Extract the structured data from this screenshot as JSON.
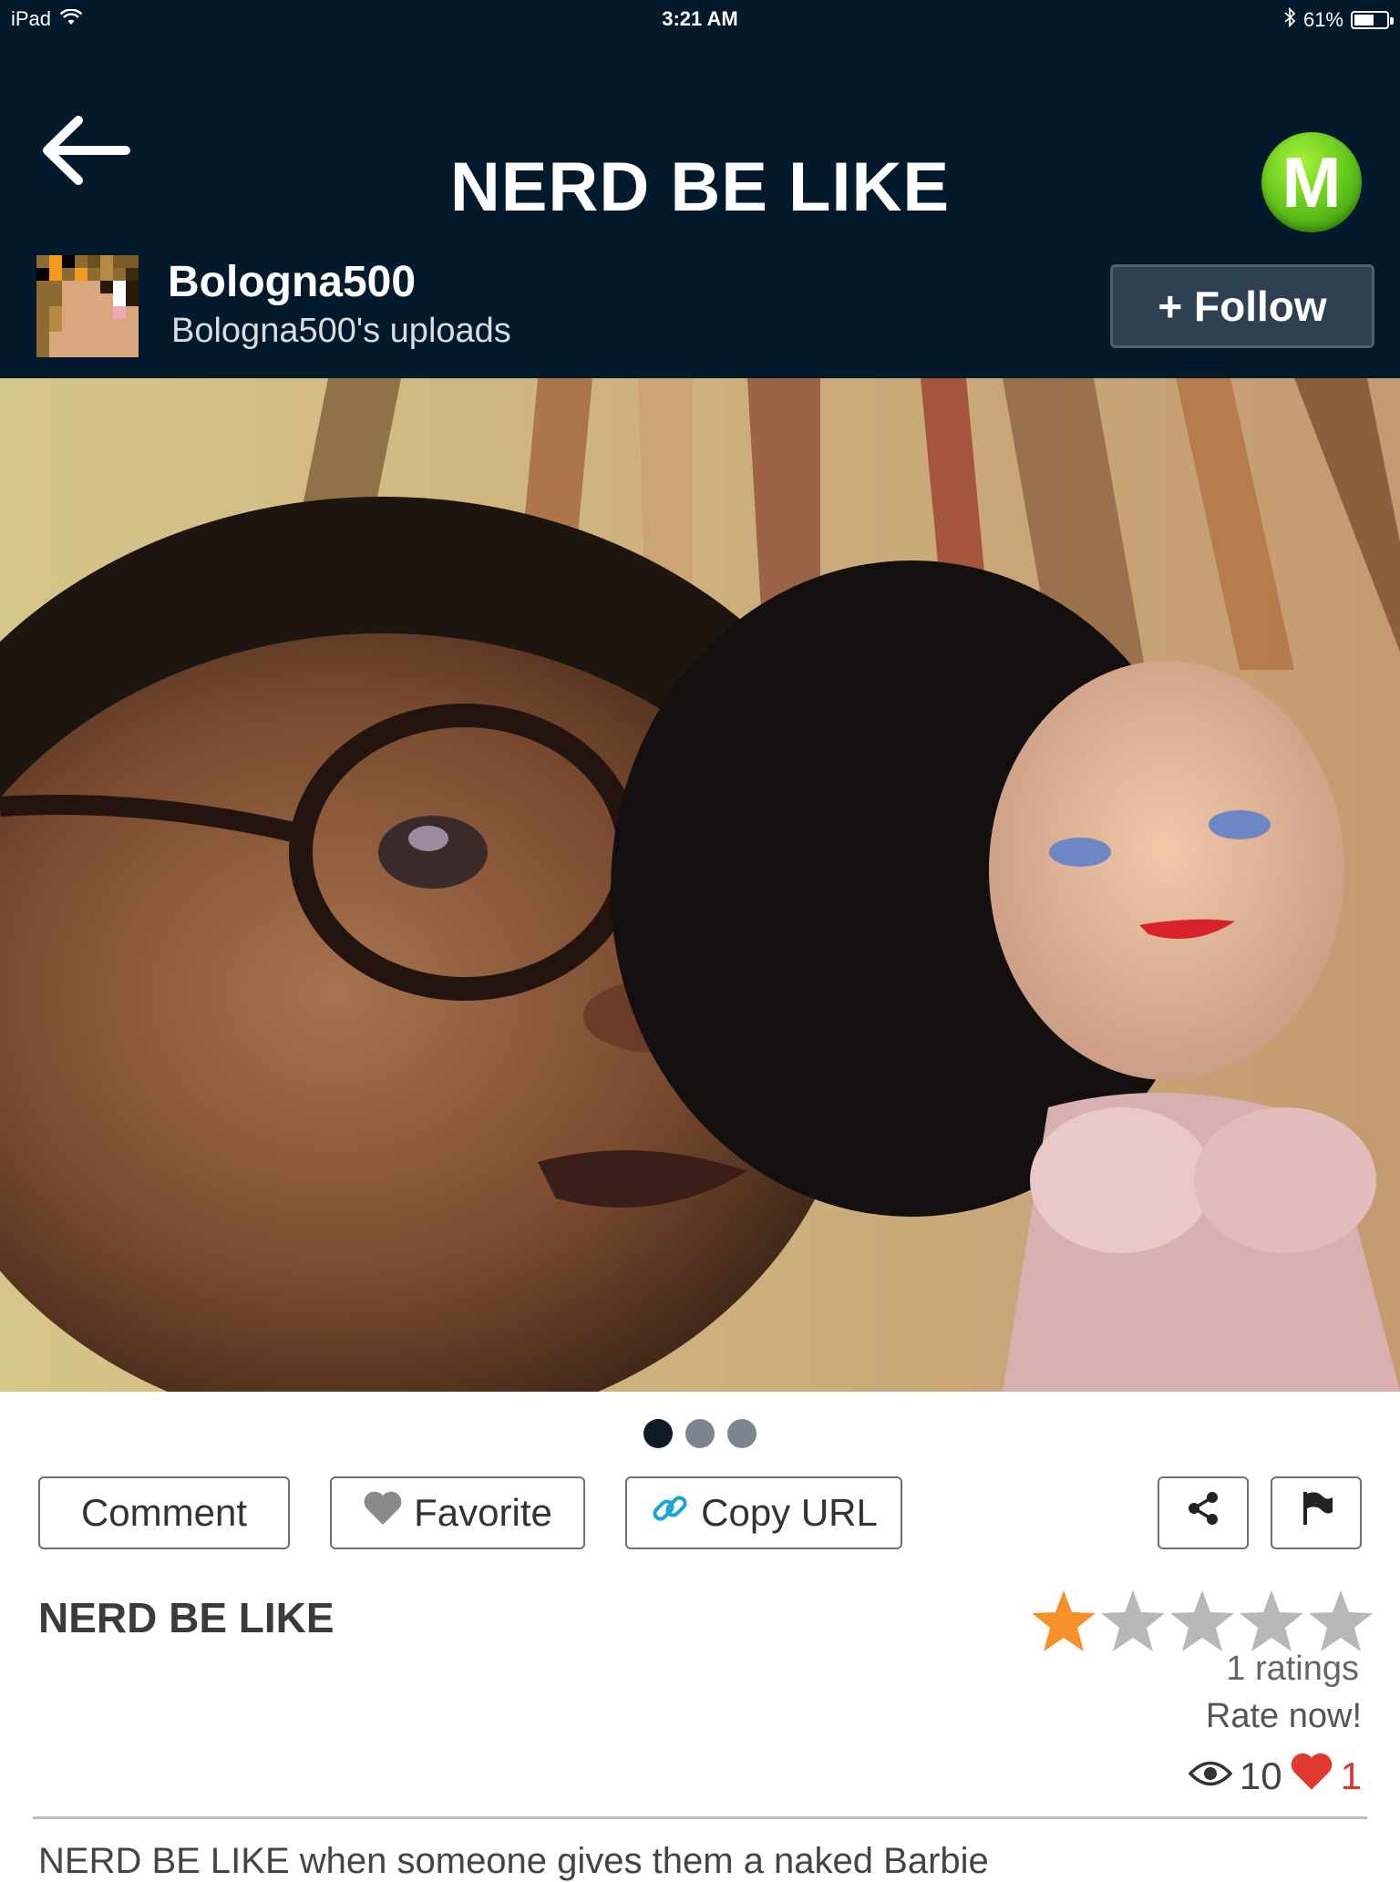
{
  "status_bar": {
    "device": "iPad",
    "time": "3:21 AM",
    "battery": "61%",
    "battery_level": 0.61
  },
  "header": {
    "title": "NERD BE LIKE",
    "logo_letter": "M",
    "accent_color": "#031a2c"
  },
  "user": {
    "name": "Bologna500",
    "uploads_label": "Bologna500's uploads",
    "follow_label": "+ Follow"
  },
  "pager": {
    "total": 3,
    "active_index": 0
  },
  "actions": {
    "comment": "Comment",
    "favorite": "Favorite",
    "copy_url": "Copy URL",
    "share_icon": "share-icon",
    "flag_icon": "flag-icon"
  },
  "post": {
    "title": "NERD BE LIKE",
    "rating": 1,
    "max_rating": 5,
    "ratings_count": "1 ratings",
    "rate_now": "Rate now!",
    "views": "10",
    "likes": "1",
    "description": "NERD BE LIKE when someone gives them a naked Barbie"
  }
}
